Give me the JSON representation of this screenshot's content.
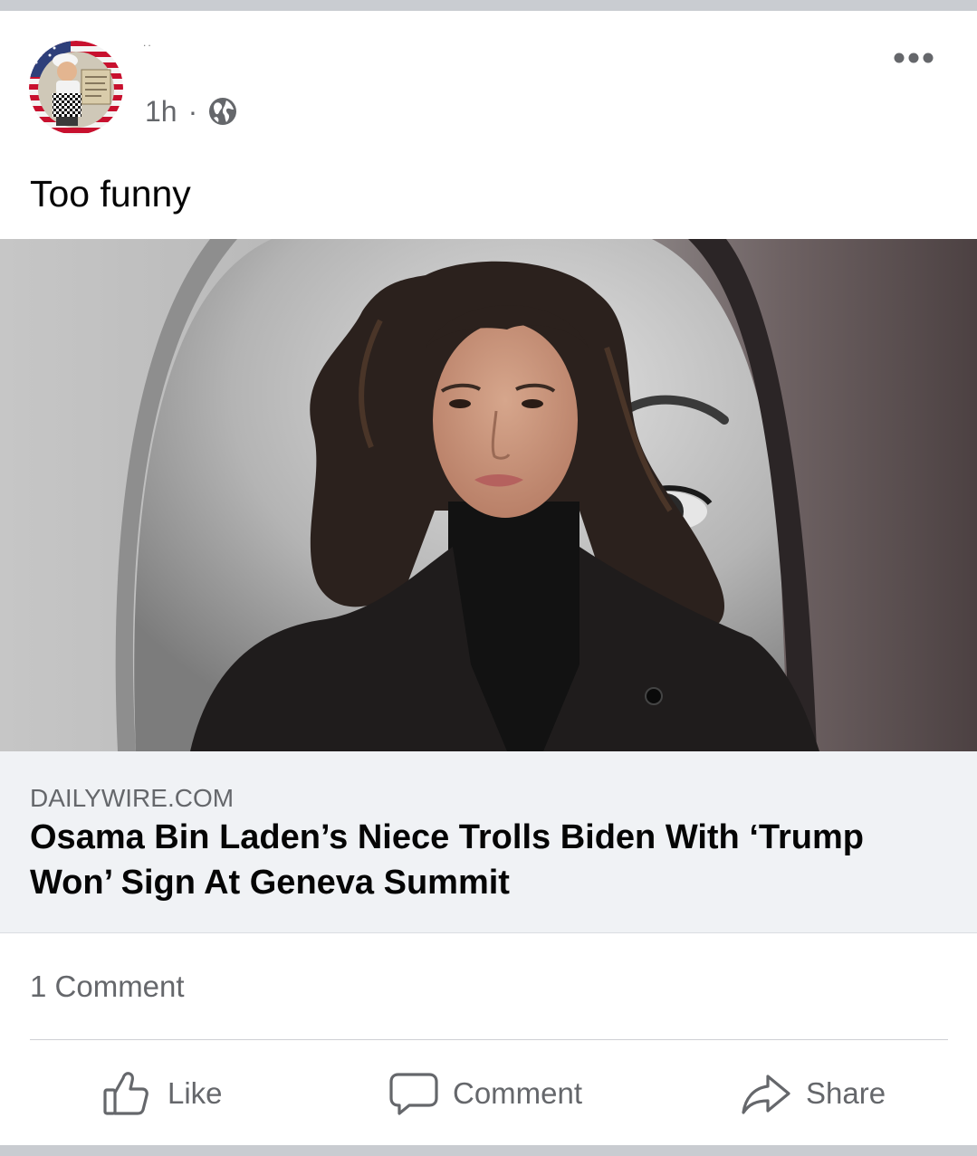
{
  "post": {
    "author_name": "..",
    "timestamp": "1h",
    "separator": "·",
    "privacy_icon": "globe-icon",
    "more_icon": "more-options-icon",
    "text": "Too funny"
  },
  "link_preview": {
    "domain": "DAILYWIRE.COM",
    "title": "Osama Bin Laden’s Niece Trolls Biden With ‘Trump Won’ Sign At Geneva Summit"
  },
  "engagement": {
    "comment_count": "1 Comment"
  },
  "actions": [
    {
      "label": "Like",
      "icon": "thumbs-up-icon"
    },
    {
      "label": "Comment",
      "icon": "comment-icon"
    },
    {
      "label": "Share",
      "icon": "share-icon"
    }
  ],
  "colors": {
    "page_background": "#c9ccd1",
    "card_background": "#ffffff",
    "primary_text": "#050505",
    "secondary_text": "#65676b",
    "link_preview_background": "#f0f2f5",
    "divider": "#ced0d4"
  }
}
